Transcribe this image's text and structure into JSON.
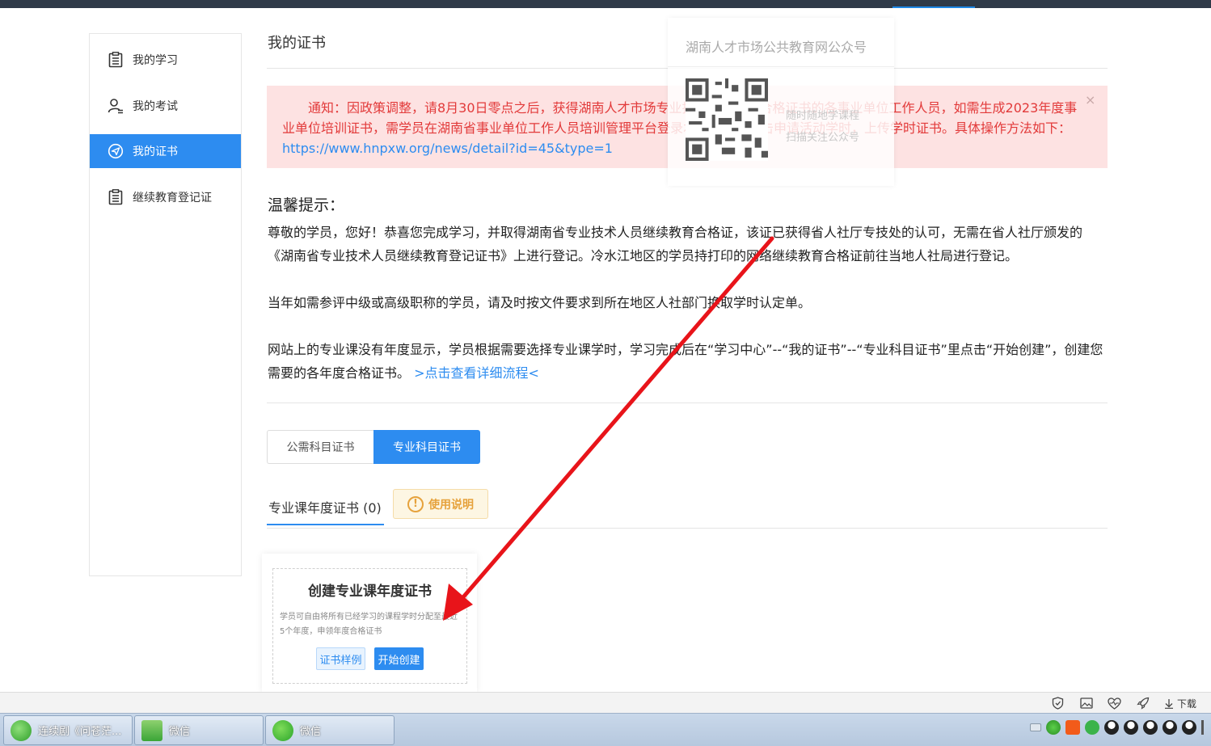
{
  "sidebar": {
    "items": [
      {
        "label": "我的学习",
        "icon": "clipboard-icon"
      },
      {
        "label": "我的考试",
        "icon": "user-list-icon"
      },
      {
        "label": "我的证书",
        "icon": "send-icon",
        "active": true
      },
      {
        "label": "继续教育登记证",
        "icon": "clipboard-icon"
      }
    ]
  },
  "main": {
    "title": "我的证书",
    "notice": {
      "text": "通知：因政策调整，请8月30日零点之后，获得湖南人才市场专业技术人员培训合格证书的各事业单位工作人员，如需生成2023年度事业单位培训证书，需学员在湖南省事业单位工作人员培训管理平台登录本人账户，点击申请活动学时，上传学时证书。具体操作方法如下：",
      "link": "https://www.hnpxw.org/news/detail?id=45&type=1",
      "close": "×"
    },
    "qr_popup": {
      "title": "湖南人才市场公共教育网公众号",
      "sub1": "随时随地学课程",
      "sub2": "扫描关注公众号"
    },
    "tips": {
      "title": "温馨提示：",
      "p1": "尊敬的学员，您好！恭喜您完成学习，并取得湖南省专业技术人员继续教育合格证，该证已获得省人社厅专技处的认可，无需在省人社厅颁发的《湖南省专业技术人员继续教育登记证书》上进行登记。冷水江地区的学员持打印的网络继续教育合格证前往当地人社局进行登记。",
      "p2": "当年如需参评中级或高级职称的学员，请及时按文件要求到所在地区人社部门换取学时认定单。",
      "p3": "网站上的专业课没有年度显示，学员根据需要选择专业课学时，学习完成后在“学习中心”--“我的证书”--“专业科目证书”里点击“开始创建”，创建您需要的各年度合格证书。",
      "p3_link": ">点击查看详细流程<"
    },
    "tabs": {
      "public": "公需科目证书",
      "pro": "专业科目证书"
    },
    "subtab": "专业课年度证书 (0)",
    "usage_btn": "使用说明",
    "card": {
      "title": "创建专业课年度证书",
      "desc": "学员可自由将所有已经学习的课程学时分配至最近5个年度，申领年度合格证书",
      "sample": "证书样例",
      "create": "开始创建"
    }
  },
  "statusbar": {
    "download": "下载"
  },
  "taskbar": {
    "items": [
      "连续剧《问苍茫...",
      "微信",
      "微信"
    ]
  },
  "colors": {
    "primary": "#2d8cf0",
    "notice_bg": "#fde2e2",
    "notice_text": "#e23a3a",
    "arrow": "#e8141a"
  }
}
